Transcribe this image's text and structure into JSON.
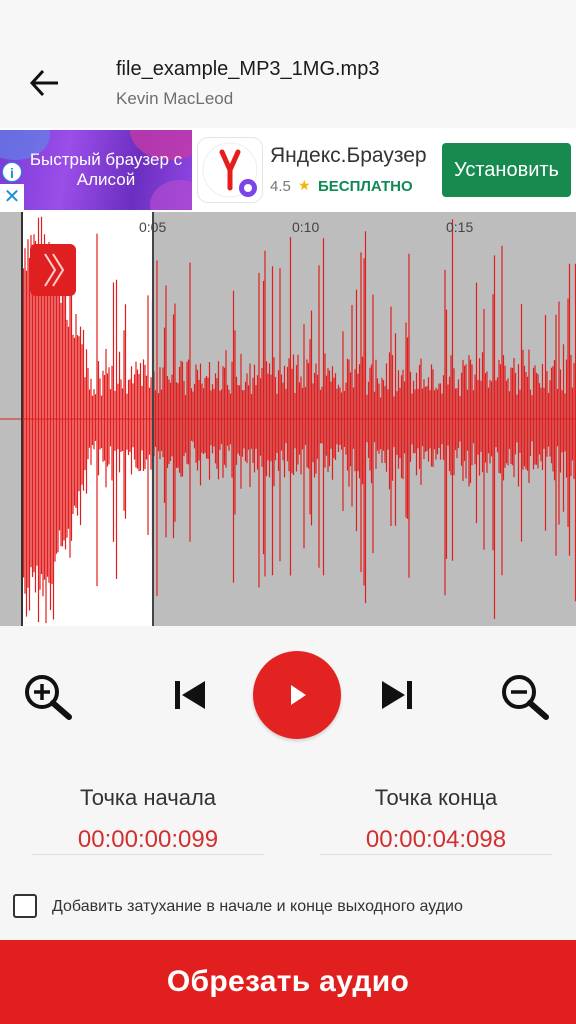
{
  "header": {
    "title": "file_example_MP3_1MG.mp3",
    "subtitle": "Kevin MacLeod",
    "back_icon": "arrow-left-icon"
  },
  "ad": {
    "image_text": "Быстрый браузер с Алисой",
    "app_name": "Яндекс.Браузер",
    "rating": "4.5",
    "price": "БЕСПЛАТНО",
    "install_label": "Установить",
    "info_icon": "info-icon",
    "close_icon": "close-icon",
    "accent_color": "#168a4f"
  },
  "waveform": {
    "time_labels": [
      "0:05",
      "0:10",
      "0:15"
    ],
    "wave_color": "#e01e1e",
    "selection_start": "00:00:00:099",
    "selection_end": "00:00:04:098"
  },
  "controls": {
    "zoom_in_icon": "zoom-in-icon",
    "prev_icon": "skip-previous-icon",
    "play_icon": "play-icon",
    "next_icon": "skip-next-icon",
    "zoom_out_icon": "zoom-out-icon"
  },
  "points": {
    "start_label": "Точка начала",
    "start_value": "00:00:00:099",
    "end_label": "Точка конца",
    "end_value": "00:00:04:098"
  },
  "fade": {
    "label": "Добавить затухание в начале и конце выходного аудио",
    "checked": false
  },
  "action": {
    "cut_label": "Обрезать аудио",
    "color": "#e21f1f"
  }
}
